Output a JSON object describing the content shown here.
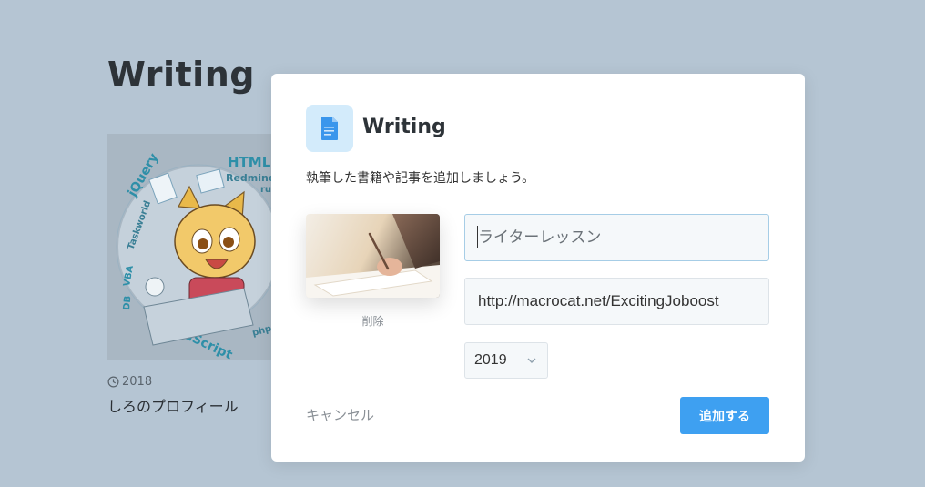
{
  "page": {
    "title": "Writing"
  },
  "card": {
    "year": "2018",
    "title": "しろのプロフィール",
    "image_labels": [
      "HTML",
      "Redmine",
      "jQuery",
      "Taskworld",
      "VBA",
      "DB",
      "JavaScript",
      "php",
      "ruby"
    ]
  },
  "modal": {
    "title": "Writing",
    "icon": "document-icon",
    "description": "執筆した書籍や記事を追加しましょう。",
    "delete_label": "削除",
    "title_placeholder": "ライターレッスン",
    "url_value": "http://macrocat.net/ExcitingJoboost",
    "year_value": "2019",
    "cancel_label": "キャンセル",
    "submit_label": "追加する"
  },
  "colors": {
    "background": "#b5c5d3",
    "accent": "#3ea0f1",
    "icon_bg": "#d3ebfb"
  }
}
